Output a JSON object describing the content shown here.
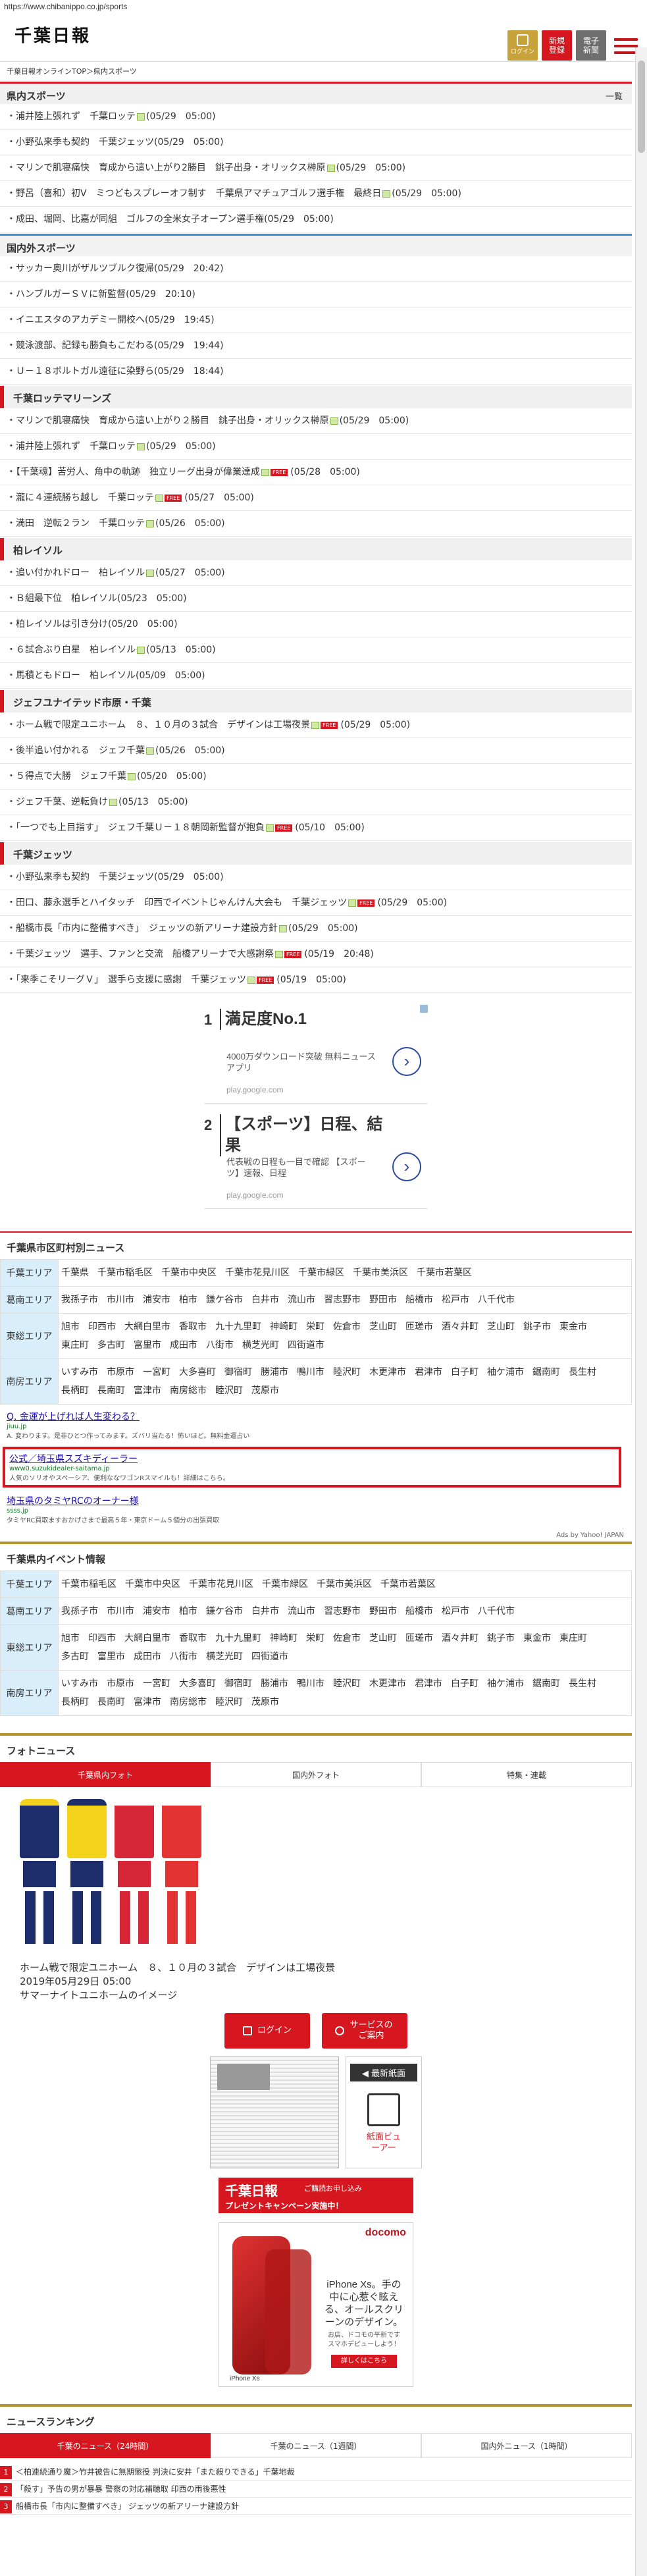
{
  "url": "https://www.chibanippo.co.jp/sports",
  "header": {
    "logo": "千葉日報",
    "btn_login": "ログイン",
    "btn_register_1": "新規",
    "btn_register_2": "登録",
    "btn_paper_1": "電子",
    "btn_paper_2": "新聞"
  },
  "breadcrumb": "千葉日報オンラインTOP＞県内スポーツ",
  "sections": [
    {
      "title": "県内スポーツ",
      "more": "一覧",
      "items": [
        {
          "text": "浦井陸上張れず　千葉ロッテ",
          "date": "(05/29　05:00)",
          "icon": true
        },
        {
          "text": "小野弘来季も契約　千葉ジェッツ",
          "date": "(05/29　05:00)"
        },
        {
          "text": "マリンで肌寝痛快　育成から這い上がり2勝目　銚子出身・オリックス榊原",
          "date": "(05/29　05:00)",
          "icon": true
        },
        {
          "text": "野呂（喜和）初V　ミつどもスプレーオフ制す　千葉県アマチュアゴルフ選手権　最終日",
          "date": "(05/29　05:00)",
          "icon": true
        },
        {
          "text": "成田、堀岡、比嘉が同組　ゴルフの全米女子オープン選手権",
          "date": "(05/29　05:00)"
        }
      ]
    },
    {
      "title": "国内外スポーツ",
      "items": [
        {
          "text": "サッカー奥川がザルツブルク復帰",
          "date": "(05/29　20:42)"
        },
        {
          "text": "ハンブルガーＳＶに新監督",
          "date": "(05/29　20:10)"
        },
        {
          "text": "イニエスタのアカデミー開校へ",
          "date": "(05/29　19:45)"
        },
        {
          "text": "競泳渡部、記録も勝負もこだわる",
          "date": "(05/29　19:44)"
        },
        {
          "text": "Ｕ－１８ボルトガル遠征に染野ら",
          "date": "(05/29　18:44)"
        }
      ]
    },
    {
      "title": "千葉ロッテマリーンズ",
      "items": [
        {
          "text": "マリンで肌寝痛快　育成から這い上がり２勝目　銚子出身・オリックス榊原",
          "date": "(05/29　05:00)",
          "icon": true
        },
        {
          "text": "浦井陸上張れず　千葉ロッテ",
          "date": "(05/29　05:00)",
          "icon": true
        },
        {
          "text": "【千葉魂】苦労人、角中の軌跡　独立リーグ出身が偉業達成",
          "date": "(05/28　05:00)",
          "icon": true,
          "free": true
        },
        {
          "text": "瀧に４連続勝ち越し　千葉ロッテ",
          "date": "(05/27　05:00)",
          "icon": true,
          "free": true
        },
        {
          "text": "満田　逆転２ラン　千葉ロッテ",
          "date": "(05/26　05:00)",
          "icon": true
        }
      ]
    },
    {
      "title": "柏レイソル",
      "items": [
        {
          "text": "追い付かれドロー　柏レイソル",
          "date": "(05/27　05:00)",
          "icon": true
        },
        {
          "text": "Ｂ組最下位　柏レイソル",
          "date": "(05/23　05:00)"
        },
        {
          "text": "柏レイソルは引き分け",
          "date": "(05/20　05:00)"
        },
        {
          "text": "６試合ぶり白星　柏レイソル",
          "date": "(05/13　05:00)",
          "icon": true
        },
        {
          "text": "馬積ともドロー　柏レイソル",
          "date": "(05/09　05:00)"
        }
      ]
    },
    {
      "title": "ジェフユナイテッド市原・千葉",
      "items": [
        {
          "text": "ホーム戦で限定ユニホーム　８、１０月の３試合　デザインは工場夜景",
          "date": "(05/29　05:00)",
          "icon": true,
          "free": true
        },
        {
          "text": "後半追い付かれる　ジェフ千葉",
          "date": "(05/26　05:00)",
          "icon": true
        },
        {
          "text": "５得点で大勝　ジェフ千葉",
          "date": "(05/20　05:00)",
          "icon": true
        },
        {
          "text": "ジェフ千葉、逆転負け",
          "date": "(05/13　05:00)",
          "icon": true
        },
        {
          "text": "「一つでも上目指す」　ジェフ千葉Ｕ－１８朝岡新監督が抱負",
          "date": "(05/10　05:00)",
          "icon": true,
          "free": true
        }
      ]
    },
    {
      "title": "千葉ジェッツ",
      "items": [
        {
          "text": "小野弘来季も契約　千葉ジェッツ",
          "date": "(05/29　05:00)"
        },
        {
          "text": "田口、藤永選手とハイタッチ　印西でイベントじゃんけん大会も　千葉ジェッツ",
          "date": "(05/29　05:00)",
          "icon": true,
          "free": true
        },
        {
          "text": "船橋市長「市内に整備すべき」　ジェッツの新アリーナ建設方針",
          "date": "(05/29　05:00)",
          "icon": true
        },
        {
          "text": "千葉ジェッツ　選手、ファンと交流　船橋アリーナで大感謝祭",
          "date": "(05/19　20:48)",
          "icon": true,
          "free": true
        },
        {
          "text": "「来季こそリーグＶ」　選手ら支援に感謝　千葉ジェッツ",
          "date": "(05/19　05:00)",
          "icon": true,
          "free": true
        }
      ]
    }
  ],
  "ads": {
    "items": [
      {
        "num": "1",
        "title": "満足度No.1",
        "desc": "4000万ダウンロード突破 無料ニュースアプリ",
        "site": "play.google.com"
      },
      {
        "num": "2",
        "title": "【スポーツ】日程、結果",
        "desc": "代表戦の日程も一目で確認 【スポーツ】速報、日程",
        "site": "play.google.com"
      }
    ],
    "arrow": "›"
  },
  "area_news": {
    "title": "千葉県市区町村別ニュース",
    "rows": [
      {
        "label": "千葉エリア",
        "values": [
          "千葉県",
          "千葉市稲毛区",
          "千葉市中央区",
          "千葉市花見川区",
          "千葉市緑区",
          "千葉市美浜区",
          "千葉市若葉区"
        ]
      },
      {
        "label": "葛南エリア",
        "values": [
          "我孫子市",
          "市川市",
          "浦安市",
          "柏市",
          "鎌ケ谷市",
          "白井市",
          "流山市",
          "習志野市",
          "野田市",
          "船橋市",
          "松戸市",
          "八千代市"
        ]
      },
      {
        "label": "東総エリア",
        "values": [
          "旭市",
          "印西市",
          "大網白里市",
          "香取市",
          "九十九里町",
          "神崎町",
          "栄町",
          "佐倉市",
          "芝山町",
          "匝瑳市",
          "酒々井町",
          "芝山町",
          "銚子市",
          "東金市",
          "東庄町",
          "多古町",
          "富里市",
          "成田市",
          "八街市",
          "横芝光町",
          "四街道市"
        ]
      },
      {
        "label": "南房エリア",
        "values": [
          "いすみ市",
          "市原市",
          "一宮町",
          "大多喜町",
          "御宿町",
          "勝浦市",
          "鴨川市",
          "睦沢町",
          "木更津市",
          "君津市",
          "白子町",
          "袖ケ浦市",
          "鋸南町",
          "長生村",
          "長柄町",
          "長南町",
          "富津市",
          "南房総市",
          "睦沢町",
          "茂原市"
        ]
      }
    ]
  },
  "text_ads": [
    {
      "title": "Q. 金運が上げれば人生変わる？",
      "url": "jiuu.jp",
      "desc": "A. 変わります。是非ひとつ作ってみます。ズバリ当たる！怖いほど。無料金運占い"
    },
    {
      "title": "公式／埼玉県スズキディーラー",
      "url": "www0.suzukidealer-saitama.jp",
      "desc": "人気のソリオやスペーシア、便利ななワゴンRスマイルも！詳細はこちら。"
    },
    {
      "title": "埼玉県のタミヤRCのオーナー様",
      "url": "ssss.jp",
      "desc": "タミヤRC買取ますおかげさまで最高５年・東京ドーム５個分の出張買取"
    }
  ],
  "ads_by": "Ads by Yahoo! JAPAN",
  "event": {
    "title": "千葉県内イベント情報",
    "rows": [
      {
        "label": "千葉エリア",
        "values": [
          "千葉市稲毛区",
          "千葉市中央区",
          "千葉市花見川区",
          "千葉市緑区",
          "千葉市美浜区",
          "千葉市若葉区"
        ]
      },
      {
        "label": "葛南エリア",
        "values": [
          "我孫子市",
          "市川市",
          "浦安市",
          "柏市",
          "鎌ケ谷市",
          "白井市",
          "流山市",
          "習志野市",
          "野田市",
          "船橋市",
          "松戸市",
          "八千代市"
        ]
      },
      {
        "label": "東総エリア",
        "values": [
          "旭市",
          "印西市",
          "大網白里市",
          "香取市",
          "九十九里町",
          "神崎町",
          "栄町",
          "佐倉市",
          "芝山町",
          "匝瑳市",
          "酒々井町",
          "銚子市",
          "東金市",
          "東庄町",
          "多古町",
          "富里市",
          "成田市",
          "八街市",
          "横芝光町",
          "四街道市"
        ]
      },
      {
        "label": "南房エリア",
        "values": [
          "いすみ市",
          "市原市",
          "一宮町",
          "大多喜町",
          "御宿町",
          "勝浦市",
          "鴨川市",
          "睦沢町",
          "木更津市",
          "君津市",
          "白子町",
          "袖ケ浦市",
          "鋸南町",
          "長生村",
          "長柄町",
          "長南町",
          "富津市",
          "南房総市",
          "睦沢町",
          "茂原市"
        ]
      }
    ]
  },
  "photo": {
    "title": "フォトニュース",
    "tabs": [
      "千葉県内フォト",
      "国内外フォト",
      "特集・連載"
    ],
    "caption_1": "ホーム戦で限定ユニホーム　８、１０月の３試合　デザインは工場夜景",
    "caption_2": "2019年05月29日 05:00",
    "caption_3": "サマーナイトユニホームのイメージ",
    "kits": [
      {
        "shirt": "#1e2d6b",
        "stripe": "#f2d21b",
        "shorts": "#1e2d6b",
        "socks": "#1e2d6b"
      },
      {
        "shirt": "#f2d21b",
        "stripe": "#1e2d6b",
        "shorts": "#1e2d6b",
        "socks": "#1e2d6b"
      },
      {
        "shirt": "#d72638",
        "stripe": "#ffffff",
        "shorts": "#d72638",
        "socks": "#d72638"
      },
      {
        "shirt": "#e33232",
        "stripe": "#ffffff",
        "shorts": "#e33232",
        "socks": "#e33232"
      }
    ]
  },
  "cta": {
    "login": "ログイン",
    "service": "サービスのご案内",
    "latest": "◀ 最新紙面",
    "viewer": "紙面ビューアー"
  },
  "promo": {
    "logo": "千葉日報",
    "sub": "ご購読お申し込み",
    "line": "プレゼントキャンペーン実施中！"
  },
  "phone_ad": {
    "brand": "docomo",
    "text1": "iPhone Xs。手の中に心惹ぐ眩える、オールスクリーンのデザイン。",
    "text2": "お店、ドコモの平新です スマホデビューしよう！",
    "button": "詳しくはこちら",
    "footer": "iPhone Xs"
  },
  "ranking": {
    "title": "ニュースランキング",
    "tabs": [
      "千葉のニュース（24時間）",
      "千葉のニュース（1週間）",
      "国内外ニュース（1時間）"
    ],
    "items": [
      {
        "n": "1",
        "text": "＜柏連続通り魔＞竹井被告に無期懲役 判決に安井「また殺りできる」千葉地裁"
      },
      {
        "n": "2",
        "text": "「殺す」予告の男が暴暴 警察の対応補聴取 印西の雨後悪性"
      },
      {
        "n": "3",
        "text": "船橋市長「市内に整備すべき」 ジェッツの新アリーナ建設方針"
      }
    ]
  }
}
